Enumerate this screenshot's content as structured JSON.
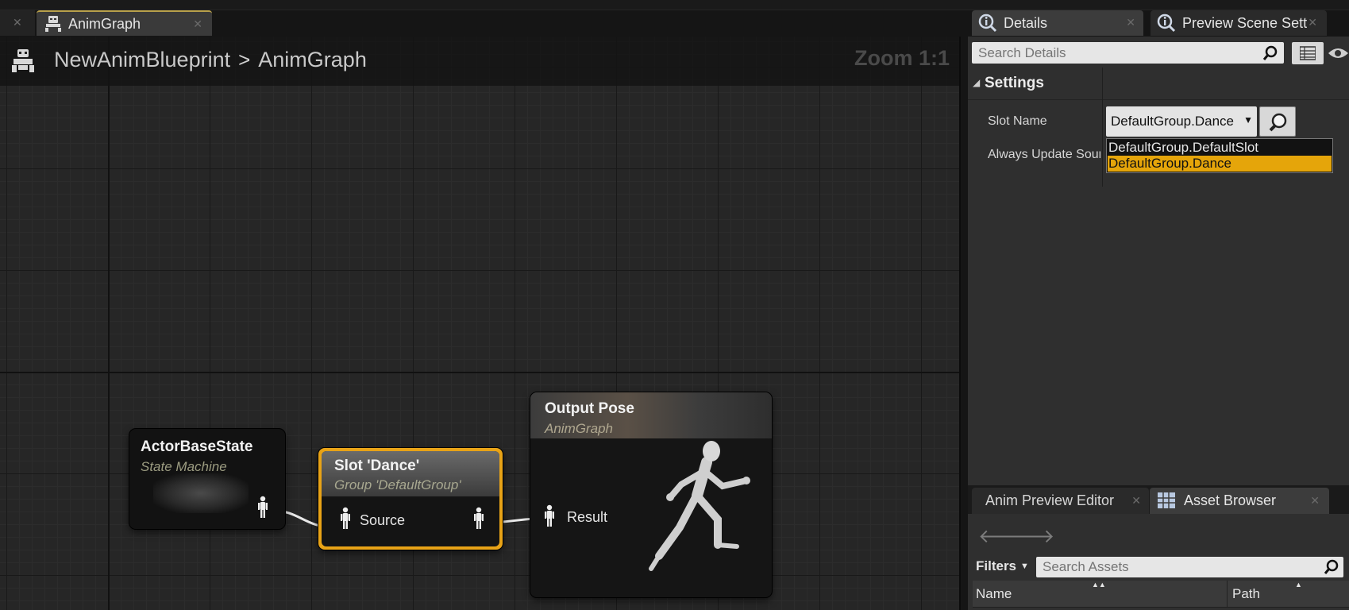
{
  "graph_tab": {
    "label": "AnimGraph"
  },
  "breadcrumb": {
    "blueprint": "NewAnimBlueprint",
    "separator": ">",
    "graph": "AnimGraph"
  },
  "zoom": "Zoom 1:1",
  "nodes": {
    "state_machine": {
      "title": "ActorBaseState",
      "subtitle": "State Machine"
    },
    "slot": {
      "title": "Slot 'Dance'",
      "subtitle": "Group 'DefaultGroup'",
      "input_label": "Source"
    },
    "output": {
      "title": "Output Pose",
      "subtitle": "AnimGraph",
      "input_label": "Result"
    }
  },
  "details_panel": {
    "tabs": [
      {
        "label": "Details",
        "icon": "info-icon"
      },
      {
        "label": "Preview Scene Sett",
        "icon": "info-icon"
      }
    ],
    "search_placeholder": "Search Details",
    "section": "Settings",
    "properties": [
      {
        "label": "Slot Name",
        "value": "DefaultGroup.Dance"
      },
      {
        "label": "Always Update Sour"
      }
    ],
    "dropdown_options": [
      {
        "label": "DefaultGroup.DefaultSlot",
        "selected": false
      },
      {
        "label": "DefaultGroup.Dance",
        "selected": true
      }
    ]
  },
  "bottom_panel": {
    "tabs": [
      {
        "label": "Anim Preview Editor"
      },
      {
        "label": "Asset Browser",
        "icon": "grid-icon"
      }
    ],
    "filters_label": "Filters",
    "search_placeholder": "Search Assets",
    "columns": [
      "Name",
      "Path"
    ]
  },
  "colors": {
    "accent_orange": "#e8a317",
    "selection": "#e5a50a",
    "graph_bg": "#262626"
  }
}
